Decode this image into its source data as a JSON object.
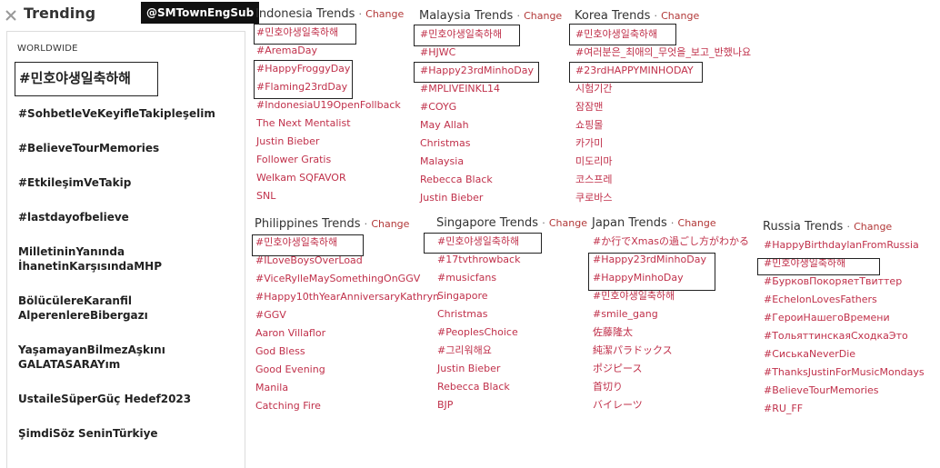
{
  "header": {
    "title": "Trending",
    "badge": "@SMTownEngSub"
  },
  "worldwide": {
    "label": "WORLDWIDE",
    "items": [
      "#민호야생일축하해",
      "#SohbetleVeKeyifleTakipleşelim",
      "#BelieveTourMemories",
      "#EtkileşimVeTakip",
      "#lastdayofbelieve",
      "MilletininYanında İhanetinKarşısındaMHP",
      "BölücülereKaranfil AlperenlereBibergazı",
      "YaşamayanBilmezAşkını GALATASARAYım",
      "UstaileSüperGüç Hedef2023",
      "ŞimdiSöz SeninTürkiye"
    ]
  },
  "change_label": "Change",
  "separator": "·",
  "columns": {
    "indonesia": {
      "title": "Indonesia Trends",
      "items": [
        "#민호야생일축하해",
        "#AremaDay",
        "#HappyFroggyDay",
        "#Flaming23rdDay",
        "#IndonesiaU19OpenFollback",
        "The Next Mentalist",
        "Justin Bieber",
        "Follower Gratis",
        "Welkam SQFAVOR",
        "SNL"
      ]
    },
    "malaysia": {
      "title": "Malaysia Trends",
      "items": [
        "#민호야생일축하해",
        "#HJWC",
        "#Happy23rdMinhoDay",
        "#MPLIVEINKL14",
        "#COYG",
        "May Allah",
        "Christmas",
        "Malaysia",
        "Rebecca Black",
        "Justin Bieber"
      ]
    },
    "korea": {
      "title": "Korea Trends",
      "items": [
        "#민호야생일축하해",
        "#여러분은_최애의_무엇을_보고_반했나요",
        "#23rdHAPPYMINHODAY",
        "시험기간",
        "잠잠맨",
        "쇼핑몰",
        "카가미",
        "미도리마",
        "코스프레",
        "쿠로바스"
      ]
    },
    "philippines": {
      "title": "Philippines Trends",
      "items": [
        "#민호야생일축하해",
        "#ILoveBoysOverLoad",
        "#ViceRylleMaySomethingOnGGV",
        "#Happy10thYearAnniversaryKathryn",
        "#GGV",
        "Aaron Villaflor",
        "God Bless",
        "Good Evening",
        "Manila",
        "Catching Fire"
      ]
    },
    "singapore": {
      "title": "Singapore Trends",
      "items": [
        "#민호야생일축하해",
        "#17tvthrowback",
        "#musicfans",
        "Singapore",
        "Christmas",
        "#PeoplesChoice",
        "#그리워해요",
        "Justin Bieber",
        "Rebecca Black",
        "BJP"
      ]
    },
    "japan": {
      "title": "Japan Trends",
      "items": [
        "#か行でXmasの過ごし方がわかる",
        "#Happy23rdMinhoDay",
        "#HappyMinhoDay",
        "#민호야생일축하해",
        "#smile_gang",
        "佐藤隆太",
        "純潔パラドックス",
        "ポジピース",
        "首切り",
        "バイレーツ"
      ]
    },
    "russia": {
      "title": "Russia Trends",
      "items": [
        "#HappyBirthdaylanFromRussia",
        "#민호야생일축하해",
        "#БурковПокоряетТвиттер",
        "#EchelonLovesFathers",
        "#ГероиНашегоВремени",
        "#ТольяттинскаяСходкаЭто",
        "#СиськаNeverDie",
        "#ThanksJustinForMusicMondays",
        "#BelieveTourMemories",
        "#RU_FF"
      ]
    }
  },
  "colors": {
    "link": "#c0304a",
    "change": "#b23838",
    "badge_bg": "#111111"
  }
}
